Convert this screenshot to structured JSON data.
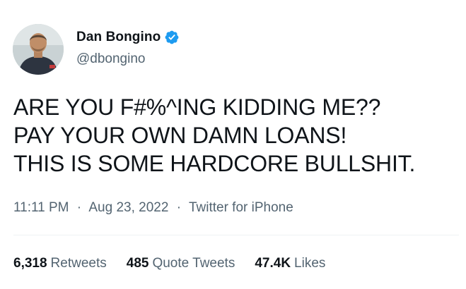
{
  "author": {
    "display_name": "Dan Bongino",
    "handle": "@dbongino",
    "verified": true,
    "avatar": "profile-photo"
  },
  "tweet": {
    "lines": [
      "ARE YOU F#%^ING KIDDING ME??",
      "PAY YOUR OWN DAMN LOANS!",
      "THIS IS SOME HARDCORE BULLSHIT."
    ],
    "time": "11:11 PM",
    "separator": "·",
    "date": "Aug 23, 2022",
    "source": "Twitter for iPhone"
  },
  "stats": {
    "retweets": {
      "count": "6,318",
      "label": "Retweets"
    },
    "quote_tweets": {
      "count": "485",
      "label": "Quote Tweets"
    },
    "likes": {
      "count": "47.4K",
      "label": "Likes"
    }
  },
  "colors": {
    "text_primary": "#0f1419",
    "text_secondary": "#536471",
    "verified_blue": "#1d9bf0",
    "divider": "#eff3f4"
  }
}
